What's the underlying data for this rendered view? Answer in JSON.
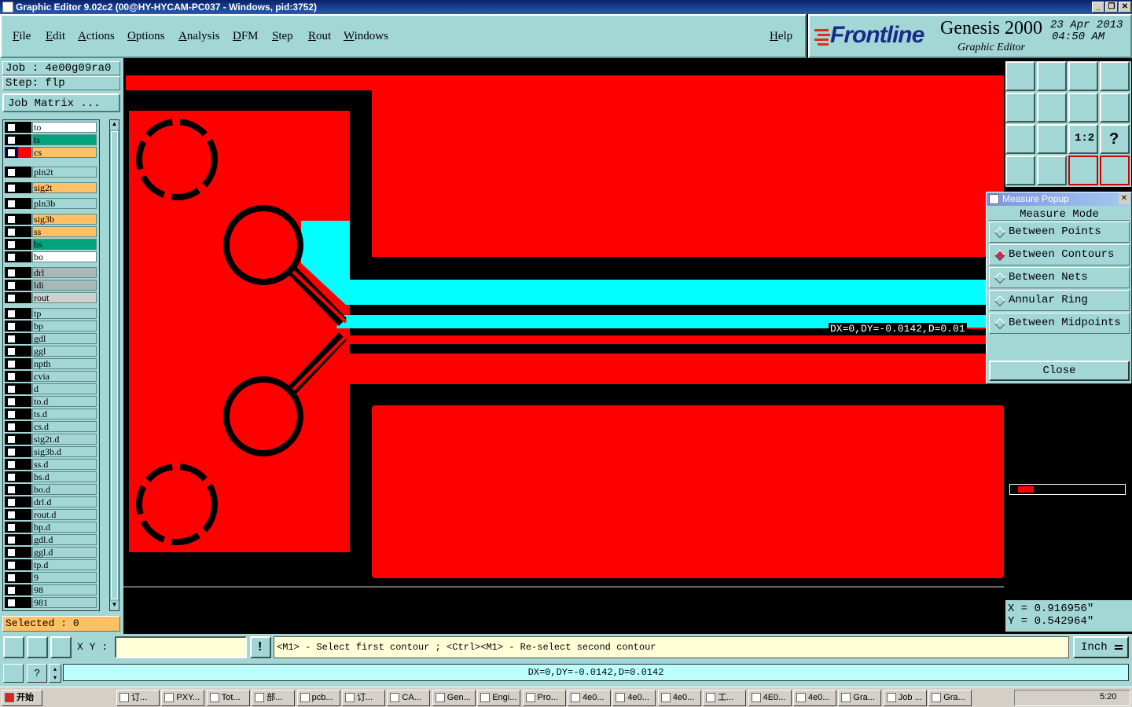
{
  "window": {
    "title": "Graphic Editor 9.02c2 (00@HY-HYCAM-PC037 - Windows, pid:3752)"
  },
  "menu": {
    "items": [
      "File",
      "Edit",
      "Actions",
      "Options",
      "Analysis",
      "DFM",
      "Step",
      "Rout",
      "Windows"
    ],
    "help": "Help"
  },
  "brand": {
    "logo": "Frontline",
    "product": "Genesis 2000",
    "subtitle": "Graphic Editor",
    "date": "23 Apr 2013",
    "time": "04:50 AM"
  },
  "job": {
    "job_label": "Job  :  4e00g09ra0",
    "step_label": "Step:  flp",
    "matrix_button": "Job Matrix ...",
    "selected": "Selected : 0"
  },
  "layers": [
    {
      "name": "to",
      "color": "#ffffff"
    },
    {
      "name": "ts",
      "color": "#00a37a"
    },
    {
      "name": "cs",
      "color": "#ffc066"
    },
    {
      "name": "pln2t",
      "color": "#a2d7d6"
    },
    {
      "name": "sig2t",
      "color": "#ffc066"
    },
    {
      "name": "pln3b",
      "color": "#a2d7d6"
    },
    {
      "name": "sig3b",
      "color": "#ffc066"
    },
    {
      "name": "ss",
      "color": "#ffc066"
    },
    {
      "name": "bs",
      "color": "#00a37a"
    },
    {
      "name": "bo",
      "color": "#ffffff"
    },
    {
      "name": "drl",
      "color": "#a9b7b7"
    },
    {
      "name": "ldi",
      "color": "#a9b7b7"
    },
    {
      "name": "rout",
      "color": "#d0d0d0"
    },
    {
      "name": "tp",
      "color": "#a2d7d6"
    },
    {
      "name": "bp",
      "color": "#a2d7d6"
    },
    {
      "name": "gdl",
      "color": "#a2d7d6"
    },
    {
      "name": "ggl",
      "color": "#a2d7d6"
    },
    {
      "name": "npth",
      "color": "#a2d7d6"
    },
    {
      "name": "cvia",
      "color": "#a2d7d6"
    },
    {
      "name": "d",
      "color": "#a2d7d6"
    },
    {
      "name": "to.d",
      "color": "#a2d7d6"
    },
    {
      "name": "ts.d",
      "color": "#a2d7d6"
    },
    {
      "name": "cs.d",
      "color": "#a2d7d6"
    },
    {
      "name": "sig2t.d",
      "color": "#a2d7d6"
    },
    {
      "name": "sig3b.d",
      "color": "#a2d7d6"
    },
    {
      "name": "ss.d",
      "color": "#a2d7d6"
    },
    {
      "name": "bs.d",
      "color": "#a2d7d6"
    },
    {
      "name": "bo.d",
      "color": "#a2d7d6"
    },
    {
      "name": "drl.d",
      "color": "#a2d7d6"
    },
    {
      "name": "rout.d",
      "color": "#a2d7d6"
    },
    {
      "name": "bp.d",
      "color": "#a2d7d6"
    },
    {
      "name": "gdl.d",
      "color": "#a2d7d6"
    },
    {
      "name": "ggl.d",
      "color": "#a2d7d6"
    },
    {
      "name": "tp.d",
      "color": "#a2d7d6"
    },
    {
      "name": "9",
      "color": "#a2d7d6"
    },
    {
      "name": "98",
      "color": "#a2d7d6"
    },
    {
      "name": "981",
      "color": "#a2d7d6"
    }
  ],
  "canvas": {
    "measure_label": "DX=0,DY=-0.0142,D=0.01",
    "colors": {
      "copper": "#ff0000",
      "highlight": "#00ffff",
      "background": "#000000"
    }
  },
  "popup": {
    "title": "Measure Popup",
    "heading": "Measure Mode",
    "options": [
      {
        "label": "Between Points",
        "selected": false
      },
      {
        "label": "Between Contours",
        "selected": true
      },
      {
        "label": "Between Nets",
        "selected": false
      },
      {
        "label": "Annular Ring",
        "selected": false
      },
      {
        "label": "Between Midpoints",
        "selected": false
      }
    ],
    "close": "Close"
  },
  "coords": {
    "x": "X  =  0.916956\"",
    "y": "Y  =  0.542964\""
  },
  "bottom": {
    "xy_label": "X Y :",
    "prompt": "<M1> - Select first contour ; <Ctrl><M1> - Re-select second contour",
    "units": "Inch"
  },
  "status": {
    "message": "DX=0,DY=-0.0142,D=0.0142"
  },
  "taskbar": {
    "start": "开始",
    "tasks": [
      "订...",
      "PXY...",
      "Tot...",
      "部...",
      "pcb...",
      "订...",
      "CA...",
      "Gen...",
      "Engi...",
      "Pro...",
      "4e0...",
      "4e0...",
      "4e0...",
      "工...",
      "4E0...",
      "4e0...",
      "Gra...",
      "Job ...",
      "Gra..."
    ],
    "clock": "5:20"
  }
}
